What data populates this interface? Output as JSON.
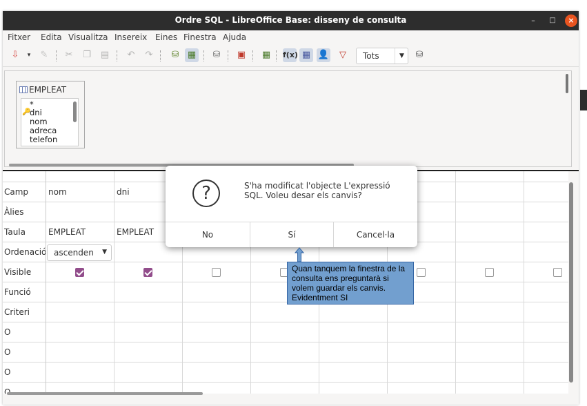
{
  "window": {
    "title": "Ordre SQL - LibreOffice Base: disseny de consulta"
  },
  "menu": [
    "Fitxer",
    "Edita",
    "Visualitza",
    "Insereix",
    "Eines",
    "Finestra",
    "Ajuda"
  ],
  "toolbar": {
    "limit_value": "Tots"
  },
  "table_window": {
    "name": "EMPLEAT",
    "fields": [
      "*",
      "dni",
      "nom",
      "adreca",
      "telefon"
    ]
  },
  "grid": {
    "row_labels": [
      "Camp",
      "Àlies",
      "Taula",
      "Ordenació",
      "Visible",
      "Funció",
      "Criteri",
      "O",
      "O",
      "O",
      "O"
    ],
    "columns": [
      {
        "field": "nom",
        "table": "EMPLEAT",
        "sort": "ascenden",
        "visible": true
      },
      {
        "field": "dni",
        "table": "EMPLEAT",
        "sort": "",
        "visible": true
      },
      {
        "field": "",
        "table": "",
        "sort": "",
        "visible": false
      },
      {
        "field": "",
        "table": "",
        "sort": "",
        "visible": false
      },
      {
        "field": "",
        "table": "",
        "sort": "",
        "visible": false
      },
      {
        "field": "",
        "table": "",
        "sort": "",
        "visible": false
      },
      {
        "field": "",
        "table": "",
        "sort": "",
        "visible": false
      },
      {
        "field": "",
        "table": "",
        "sort": "",
        "visible": false
      }
    ]
  },
  "dialog": {
    "message": "S'ha modificat l'objecte L'expressió SQL. Voleu desar els canvis?",
    "buttons": [
      "No",
      "Sí",
      "Cancel·la"
    ]
  },
  "annotation": {
    "text": "Quan tanquem la finestra de la consulta ens preguntarà si volem guardar els canvis. Evidentment SI"
  },
  "colors": {
    "accent": "#924d8b",
    "close": "#e95420",
    "note": "#729fcf"
  }
}
